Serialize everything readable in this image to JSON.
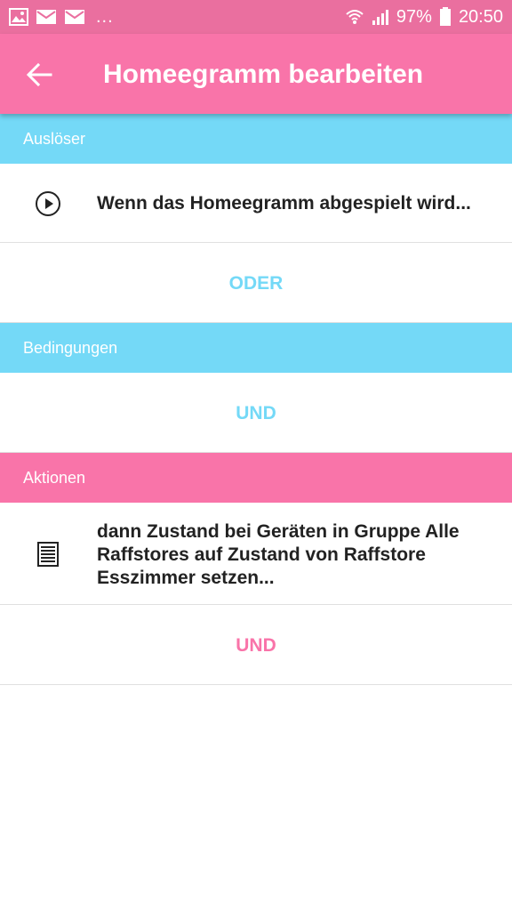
{
  "status_bar": {
    "overflow": "...",
    "battery": "97%",
    "time": "20:50",
    "left_icons": [
      "image-icon",
      "mail-icon",
      "mail-icon"
    ],
    "right_icons": [
      "wifi-icon",
      "signal-icon",
      "battery-icon"
    ]
  },
  "app_bar": {
    "title": "Homeegramm bearbeiten",
    "back_icon": "arrow-back-icon",
    "color": "#f974a9"
  },
  "sections": {
    "trigger": {
      "header": "Auslöser",
      "item_text": "Wenn das Homeegramm abgespielt wird...",
      "item_icon": "play-circle-icon",
      "button": "ODER"
    },
    "conditions": {
      "header": "Bedingungen",
      "button": "UND"
    },
    "actions": {
      "header": "Aktionen",
      "item_text": "dann Zustand bei Geräten in Gruppe Alle Raffstores  auf Zustand von Raffstore Esszimmer setzen...",
      "item_icon": "list-document-icon",
      "button": "UND"
    }
  },
  "colors": {
    "pink": "#f974a9",
    "pink_dark": "#ea6f9f",
    "blue": "#74d9f7"
  }
}
